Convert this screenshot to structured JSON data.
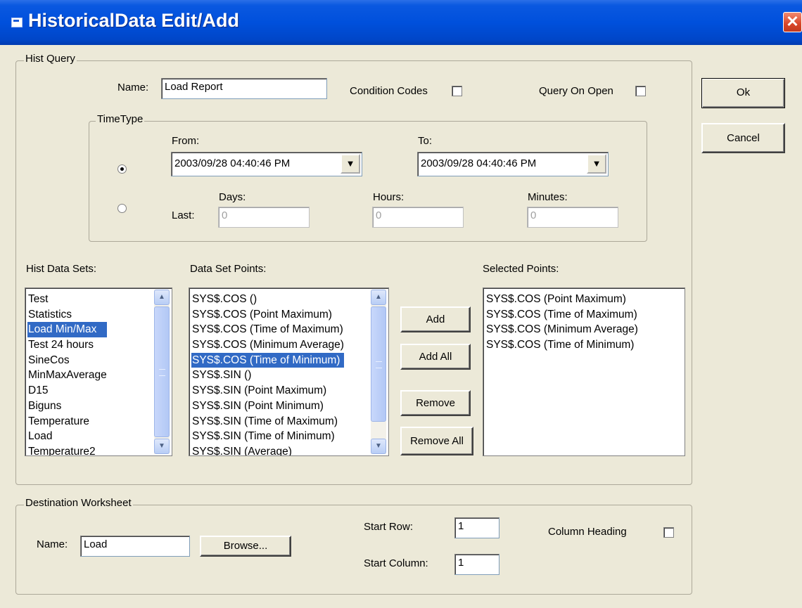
{
  "window": {
    "title": "HistoricalData Edit/Add",
    "close": "✕"
  },
  "hist_query": {
    "legend": "Hist Query",
    "name_label": "Name:",
    "name_value": "Load Report",
    "condition_codes_label": "Condition Codes",
    "condition_codes_checked": false,
    "query_on_open_label": "Query On Open",
    "query_on_open_checked": false
  },
  "time_type": {
    "legend": "TimeType",
    "from_label": "From:",
    "from_value": "2003/09/28 04:40:46 PM",
    "to_label": "To:",
    "to_value": "2003/09/28 04:40:46 PM",
    "last_label": "Last:",
    "days_label": "Days:",
    "days_value": "0",
    "hours_label": "Hours:",
    "hours_value": "0",
    "minutes_label": "Minutes:",
    "minutes_value": "0",
    "selected_option": "range"
  },
  "hist_data_sets": {
    "label": "Hist Data Sets:",
    "items": [
      "Test",
      "Statistics",
      "Load Min/Max",
      "Test 24 hours",
      "SineCos",
      "MinMaxAverage",
      "D15",
      "Biguns",
      "Temperature",
      "Load",
      "Temperature2"
    ],
    "selected": "Load Min/Max"
  },
  "data_set_points": {
    "label": "Data Set Points:",
    "items": [
      "SYS$.COS ()",
      "SYS$.COS (Point Maximum)",
      "SYS$.COS (Time of Maximum)",
      "SYS$.COS (Minimum Average)",
      "SYS$.COS (Time of Minimum)",
      "SYS$.SIN ()",
      "SYS$.SIN (Point Maximum)",
      "SYS$.SIN (Point Minimum)",
      "SYS$.SIN (Time of Maximum)",
      "SYS$.SIN (Time of Minimum)",
      "SYS$.SIN (Average)"
    ],
    "selected": "SYS$.COS (Time of Minimum)"
  },
  "selected_points": {
    "label": "Selected Points:",
    "items": [
      "SYS$.COS (Point Maximum)",
      "SYS$.COS (Time of Maximum)",
      "SYS$.COS (Minimum Average)",
      "SYS$.COS (Time of Minimum)"
    ]
  },
  "point_buttons": {
    "add": "Add",
    "add_all": "Add All",
    "remove": "Remove",
    "remove_all": "Remove All"
  },
  "destination": {
    "legend": "Destination Worksheet",
    "name_label": "Name:",
    "name_value": "Load",
    "browse": "Browse...",
    "start_row_label": "Start Row:",
    "start_row_value": "1",
    "start_column_label": "Start Column:",
    "start_column_value": "1",
    "column_heading_label": "Column Heading",
    "column_heading_checked": false
  },
  "dialog_buttons": {
    "ok": "Ok",
    "cancel": "Cancel"
  },
  "icons": {
    "titlebar": "window-icon",
    "combo_arrow": "▼",
    "scroll_up": "▲",
    "scroll_down": "▼"
  },
  "colors": {
    "titlebar": "#0050dc",
    "selection": "#316ac5",
    "face": "#ece9d8",
    "close": "#d8452a"
  }
}
